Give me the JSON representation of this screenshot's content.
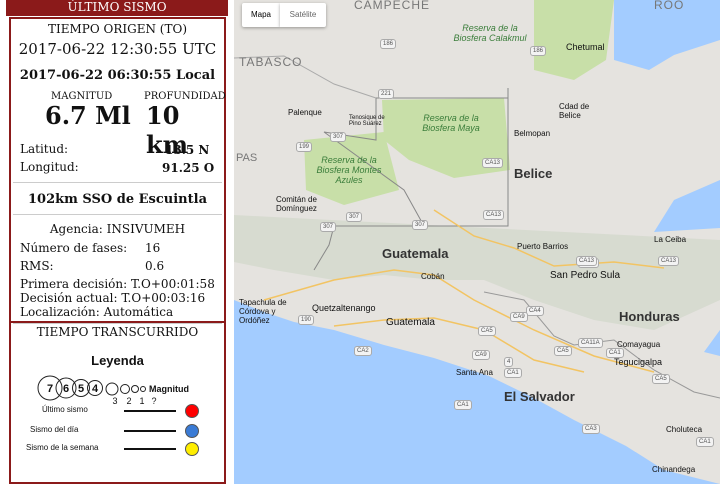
{
  "panel": {
    "header": "ÚLTIMO SISMO",
    "origin_label": "TIEMPO ORIGEN (TO)",
    "utc_time": "2017-06-22 12:30:55 UTC",
    "local_time": "2017-06-22 06:30:55 Local",
    "magnitude_label": "MAGNITUD",
    "depth_label": "PROFUNDIDAD",
    "magnitude_value": "6.7 Ml",
    "depth_value": "10 km",
    "latitude_label": "Latitud:",
    "latitude_value": "13.5 N",
    "longitude_label": "Longitud:",
    "longitude_value": "91.25 O",
    "location": "102km SSO de Escuintla",
    "agency": "Agencia: INSIVUMEH",
    "phases_label": "Número de fases:",
    "phases_value": "16",
    "rms_label": "RMS:",
    "rms_value": "0.6",
    "first_decision": "Primera decisión: T.O+00:01:58",
    "current_decision": "Decisión actual: T.O+00:03:16",
    "localization": "Localización: Automática",
    "elapsed_label": "TIEMPO TRANSCURRIDO"
  },
  "legend": {
    "title": "Leyenda",
    "magnitudes_big": [
      "7",
      "6",
      "5",
      "4"
    ],
    "magnitudes_small": [
      "3",
      "2",
      "1",
      "?"
    ],
    "magnitude_label": "Magnitud",
    "items": [
      {
        "label": "Último sismo",
        "color": "#ff0000"
      },
      {
        "label": "Sismo del día",
        "color": "#3a7bd5"
      },
      {
        "label": "Sismo de la semana",
        "color": "#ffee00"
      }
    ]
  },
  "map": {
    "type_buttons": [
      "Mapa",
      "Satélite"
    ],
    "selected_type": "Mapa",
    "colors": {
      "water": "#a3ccff",
      "land": "#e5e3df",
      "reserve": "#c8dfa8",
      "mountain": "#d3d8cc"
    },
    "labels": {
      "tabasco": "TABASCO",
      "campeche": "CAMPECHE",
      "quintana_roo": "ROO",
      "pas": "PAS",
      "calakmul": "Reserva de la Biosfera Calakmul",
      "maya": "Reserva de la Biosfera Maya",
      "montes_azules": "Reserva de la Biosfera Montes Azules",
      "chetumal": "Chetumal",
      "cdad_belice": "Cdad de Belice",
      "belmopan": "Belmopan",
      "palenque": "Palenque",
      "tenosique": "Tenosique de Pino Suárez",
      "comitan": "Comitán de Domínguez",
      "belice": "Belice",
      "guatemala_country": "Guatemala",
      "coban": "Cobán",
      "puerto_barrios": "Puerto Barrios",
      "la_ceiba": "La Ceiba",
      "san_pedro_sula": "San Pedro Sula",
      "tapachula": "Tapachula de Córdova y Ordóñez",
      "quetzaltenango": "Quetzaltenango",
      "guatemala_city": "Guatemala",
      "honduras": "Honduras",
      "comayagua": "Comayagua",
      "tegucigalpa": "Tegucigalpa",
      "santa_ana": "Santa Ana",
      "el_salvador": "El Salvador",
      "choluteca": "Choluteca",
      "chinandega": "Chinandega"
    },
    "shields": [
      "186",
      "221",
      "186",
      "307",
      "199",
      "307",
      "CA13",
      "CA13",
      "307",
      "307",
      "CA13",
      "190",
      "CA13",
      "CA13",
      "CA9",
      "CA1",
      "CA5",
      "CA5",
      "CA11A",
      "CA4",
      "CA9",
      "CA1",
      "CA2",
      "CA5",
      "4",
      "CA1",
      "CA3",
      "CA1"
    ]
  }
}
